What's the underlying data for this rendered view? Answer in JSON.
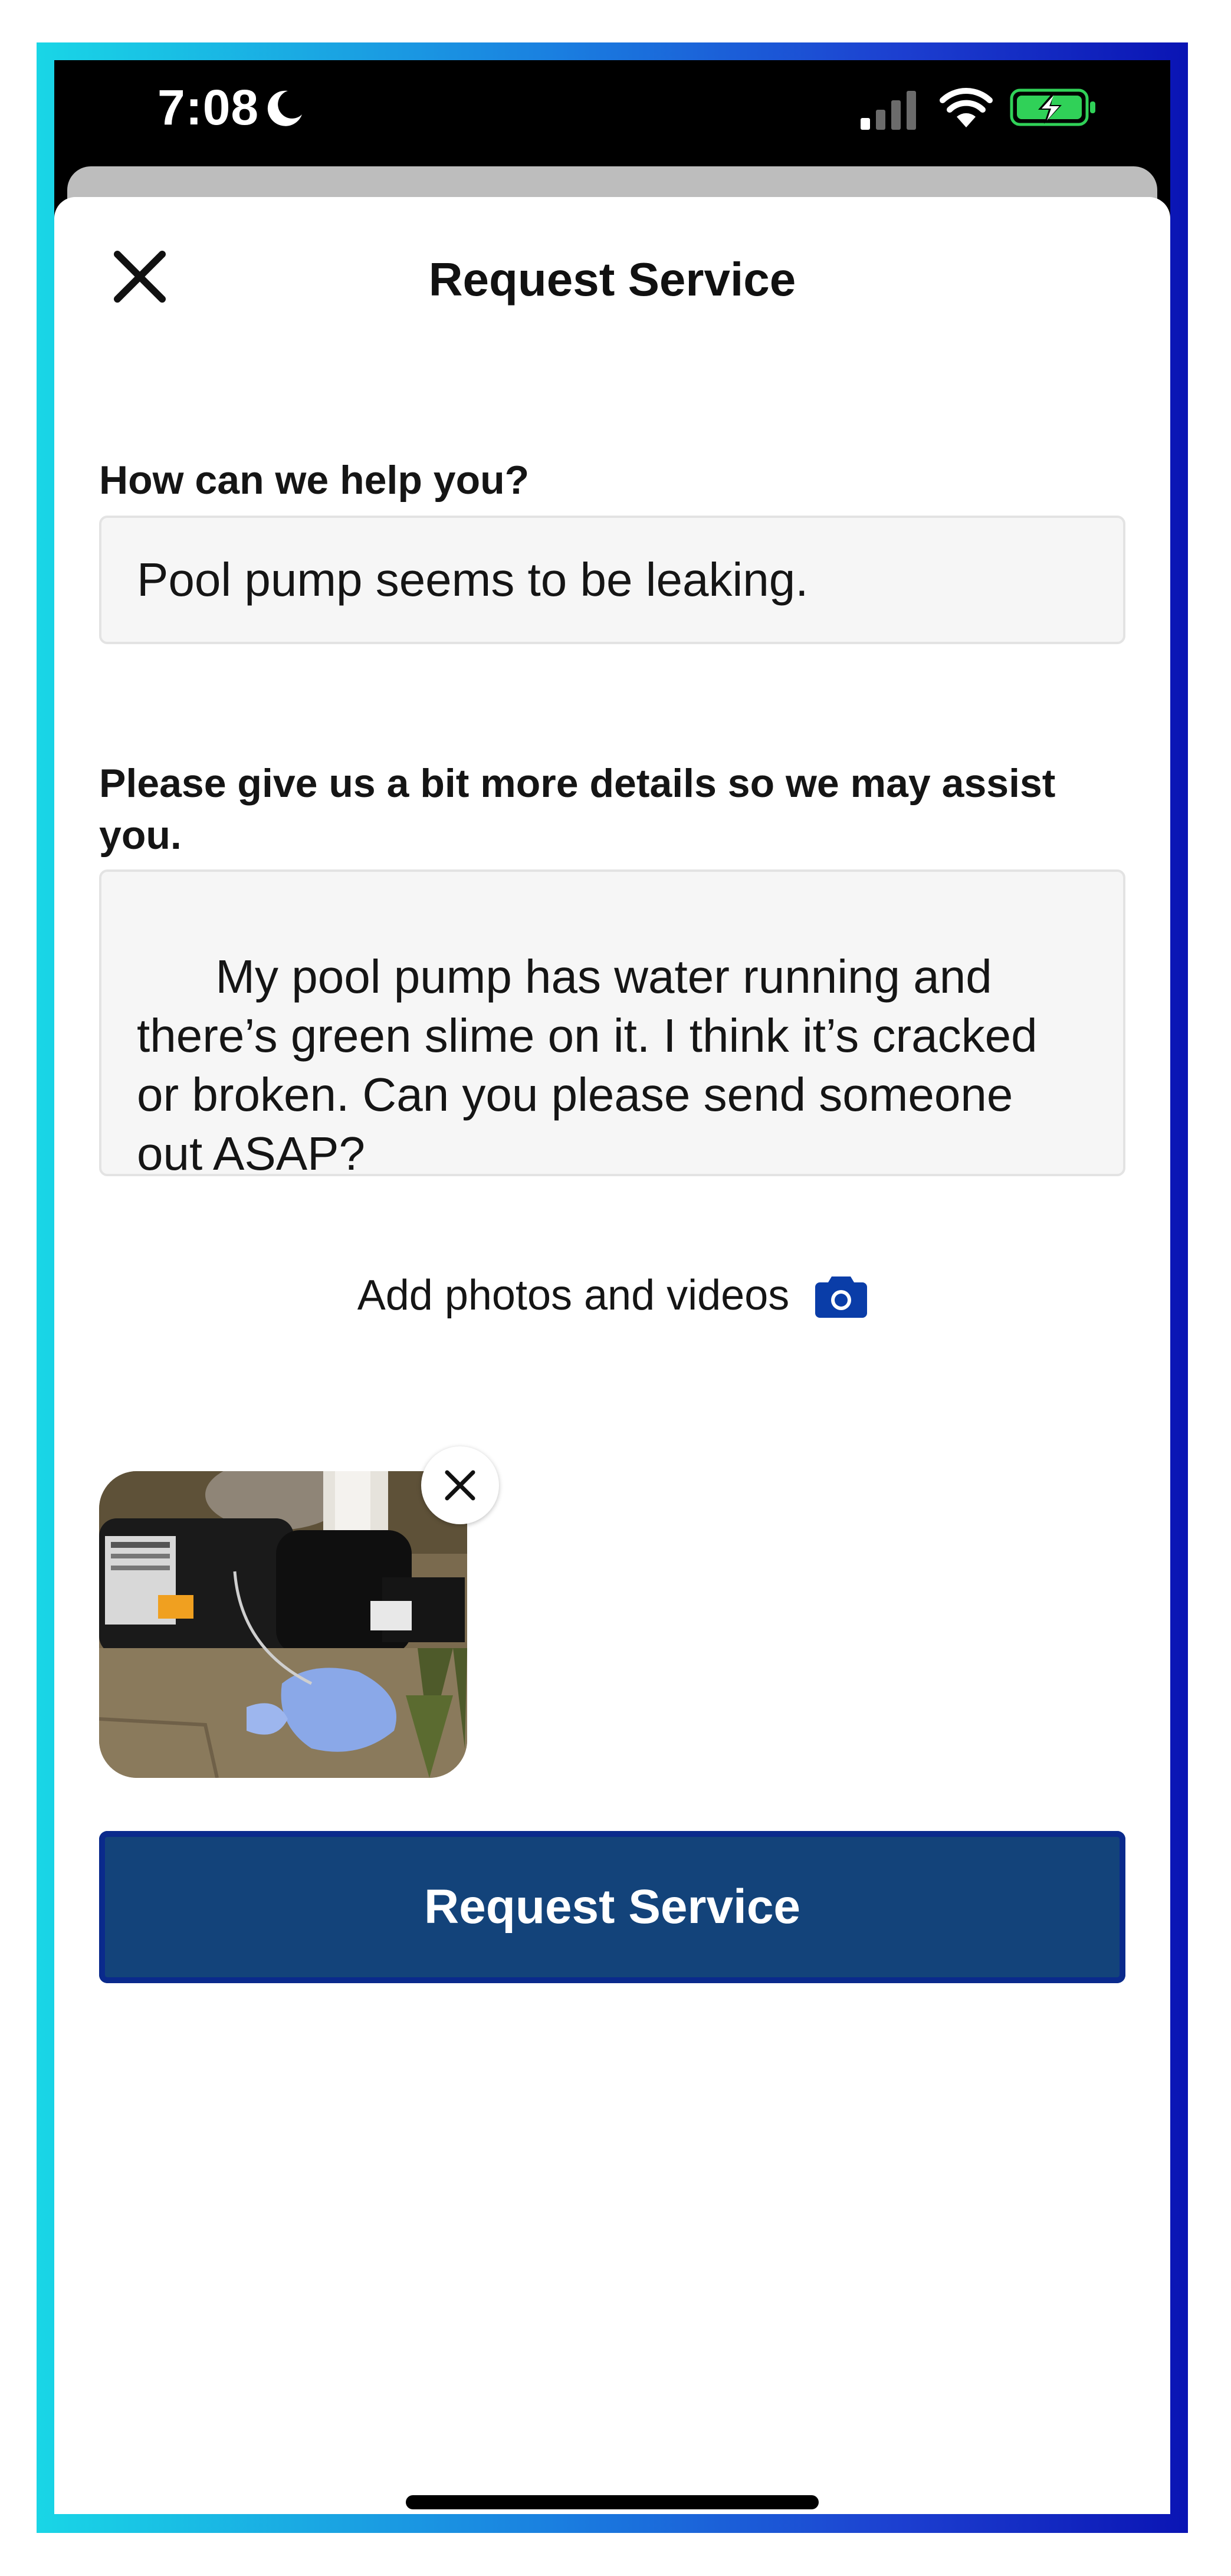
{
  "status_bar": {
    "time": "7:08",
    "icons": [
      "moon-icon",
      "cellular-signal-icon",
      "wifi-icon",
      "battery-charging-icon"
    ]
  },
  "header": {
    "title": "Request Service",
    "close_icon": "close-icon"
  },
  "form": {
    "summary_label": "How can we help you?",
    "summary_value": "Pool pump seems to be leaking.",
    "details_label": "Please give us a bit more details so we may assist you.",
    "details_value": "My pool pump has water running and there’s green slime on it. I think it’s cracked or broken. Can you please send someone out ASAP?",
    "add_media_label": "Add photos and videos",
    "add_media_icon": "camera-icon",
    "attachments": [
      {
        "type": "photo",
        "subject": "pool pump"
      }
    ],
    "submit_label": "Request Service"
  },
  "colors": {
    "primary_button": "#13437a",
    "camera_icon": "#0a3da8",
    "battery_fill": "#30d158"
  }
}
